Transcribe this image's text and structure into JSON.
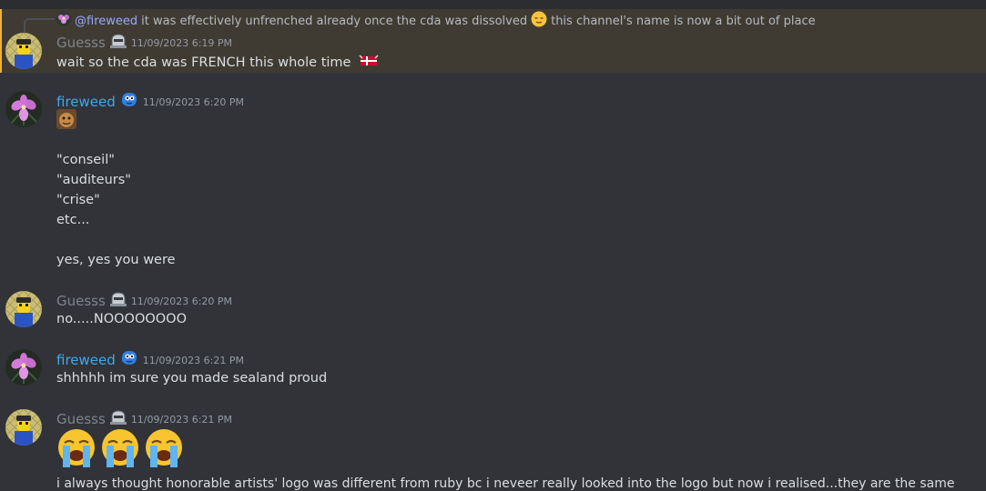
{
  "reply": {
    "mention": "@fireweed",
    "text_a": "it was effectively unfrenched already once the cda was dissolved",
    "text_b": "this channel's name is now a bit out of place"
  },
  "messages": [
    {
      "author": "Guesss",
      "timestamp": "11/09/2023 6:19 PM",
      "lines": [
        "wait so the cda was FRENCH this whole time"
      ]
    },
    {
      "author": "fireweed",
      "timestamp": "11/09/2023 6:20 PM",
      "lines": [
        "\"conseil\"",
        "\"auditeurs\"",
        "\"crise\"",
        "etc...",
        "yes, yes you were"
      ]
    },
    {
      "author": "Guesss",
      "timestamp": "11/09/2023 6:20 PM",
      "lines": [
        "no.....NOOOOOOOO"
      ]
    },
    {
      "author": "fireweed",
      "timestamp": "11/09/2023 6:21 PM",
      "lines": [
        "shhhhh im sure you made sealand proud"
      ]
    },
    {
      "author": "Guesss",
      "timestamp": "11/09/2023 6:21 PM",
      "lines": [
        "i always thought honorable artists' logo was different from ruby bc i neveer really looked into the logo but now i realised...they are the same"
      ]
    }
  ],
  "icons": {
    "guesss_avatar": "lego-minifig-avatar",
    "fireweed_avatar": "pink-flower-avatar",
    "guesss_badge": "helmet-badge-icon",
    "fireweed_badge": "blue-blob-badge-icon",
    "relieved_emoji": "relieved-face-emoji",
    "flag_emoji": "flag-emoji",
    "custom_emoji": "custom-face-emoji",
    "crying_emoji": "loudly-crying-face-emoji"
  },
  "colors": {
    "background": "#313338",
    "highlight": "#3f3b33",
    "fireweed_name": "#3fa9e8",
    "guesss_name": "#80848e"
  }
}
